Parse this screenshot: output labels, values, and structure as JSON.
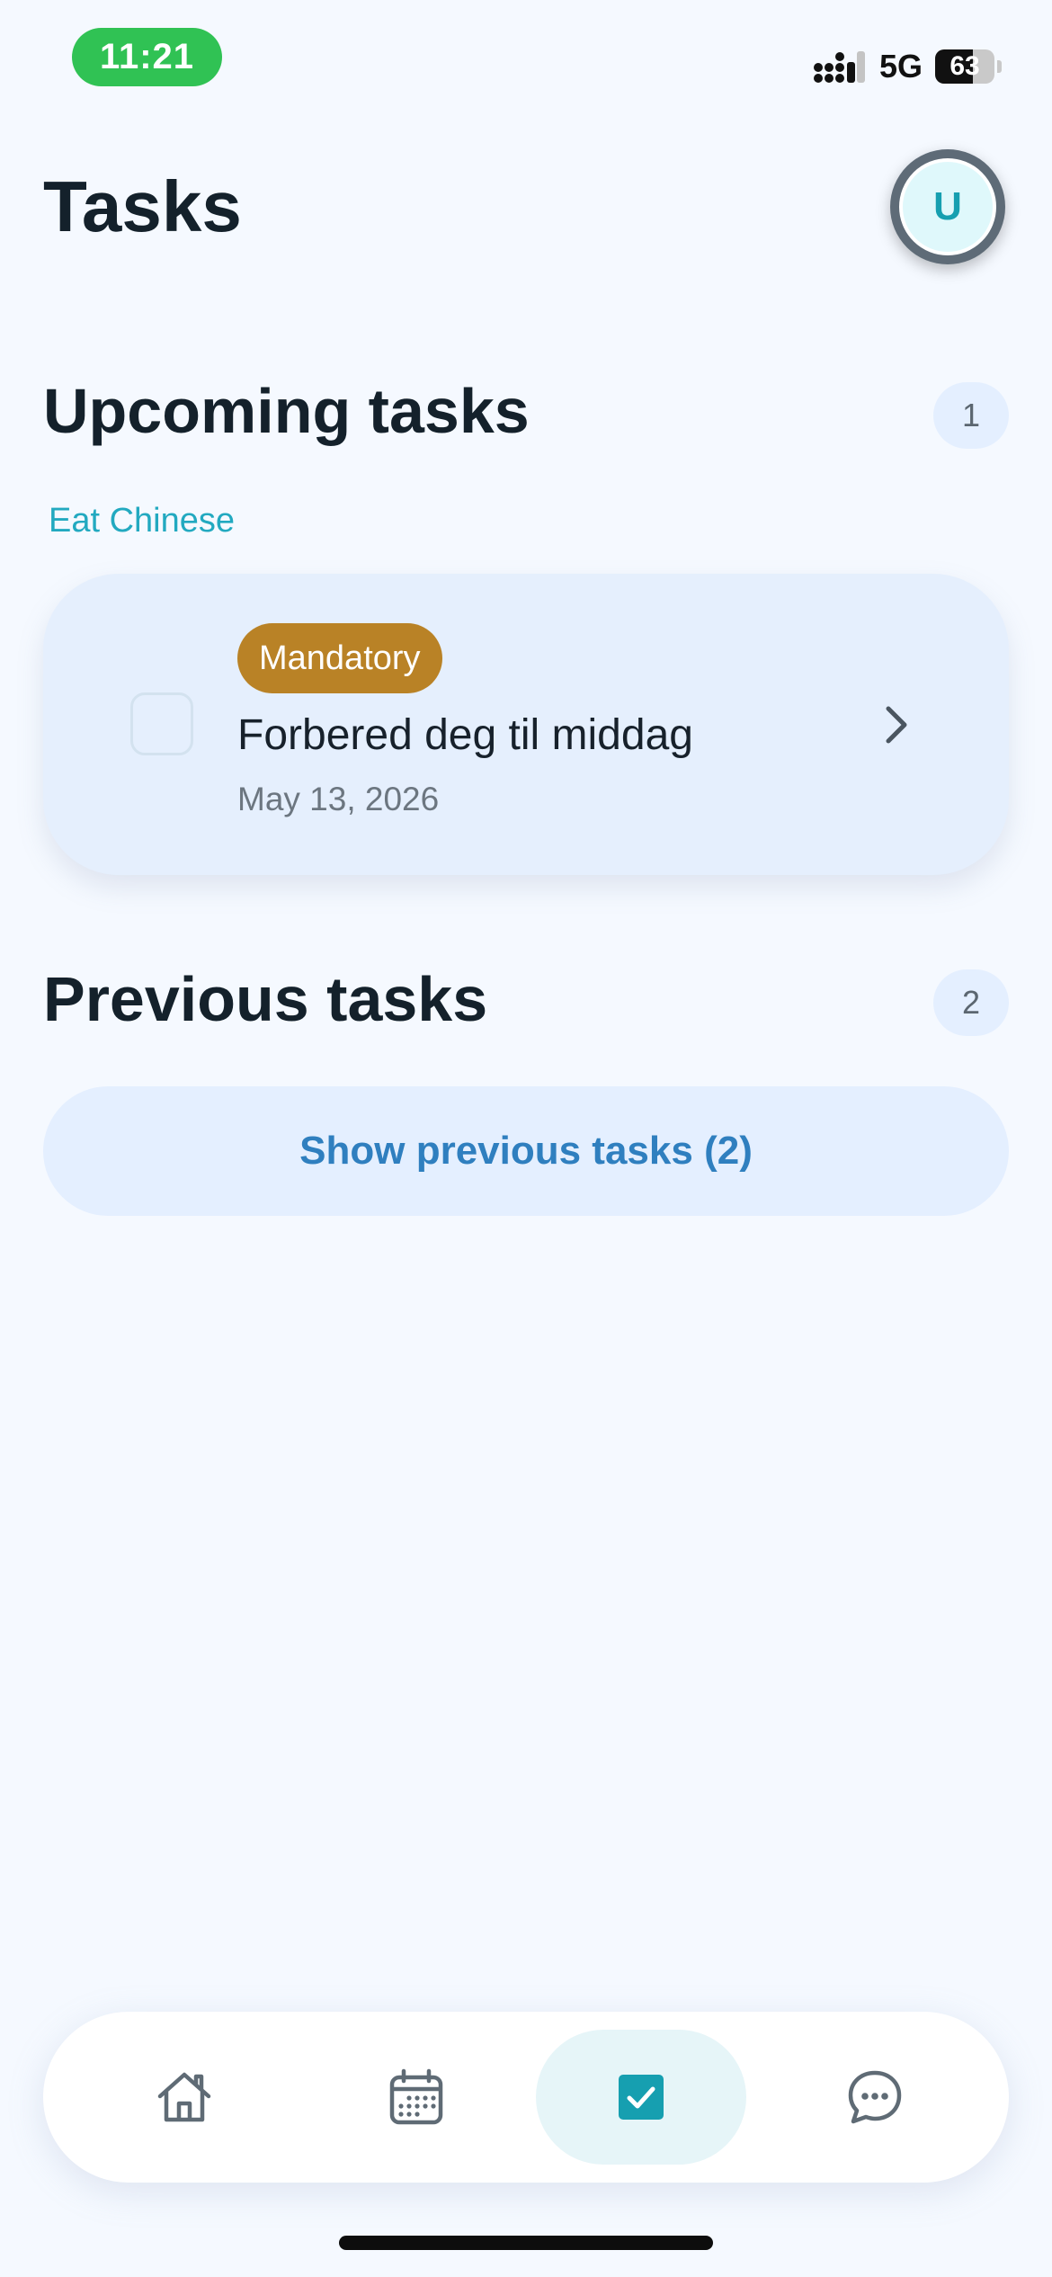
{
  "status_bar": {
    "time": "11:21",
    "network": "5G",
    "battery_level": "63"
  },
  "header": {
    "title": "Tasks",
    "avatar_initial": "U"
  },
  "upcoming": {
    "title": "Upcoming tasks",
    "count": "1",
    "group_label": "Eat Chinese",
    "tasks": [
      {
        "tag": "Mandatory",
        "title": "Forbered deg til middag",
        "date": "May 13, 2026",
        "done": false
      }
    ]
  },
  "previous": {
    "title": "Previous tasks",
    "count": "2",
    "show_button_label": "Show previous tasks (2)"
  },
  "bottom_nav": {
    "items": [
      {
        "name": "home",
        "icon": "home-icon",
        "active": false
      },
      {
        "name": "calendar",
        "icon": "calendar-icon",
        "active": false
      },
      {
        "name": "tasks",
        "icon": "checkbox-checked-icon",
        "active": true
      },
      {
        "name": "messages",
        "icon": "chat-bubble-icon",
        "active": false
      }
    ]
  },
  "colors": {
    "background": "#f5f9ff",
    "accent": "#169fb0",
    "tag_mandatory": "#b98226",
    "status_time_pill": "#30c254",
    "link_blue": "#2f7fbf"
  }
}
